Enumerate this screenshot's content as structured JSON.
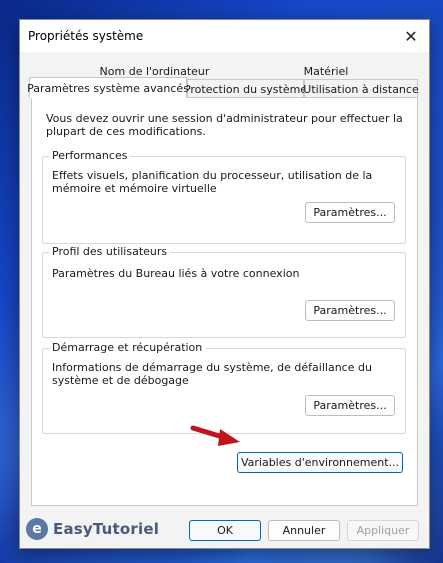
{
  "window": {
    "title": "Propriétés système"
  },
  "tabs_back": [
    {
      "label": "Nom de l'ordinateur"
    },
    {
      "label": "Matériel"
    }
  ],
  "tabs_front": [
    {
      "label": "Paramètres système avancés",
      "active": true
    },
    {
      "label": "Protection du système"
    },
    {
      "label": "Utilisation à distance"
    }
  ],
  "intro": "Vous devez ouvrir une session d'administrateur pour effectuer la plupart de ces modifications.",
  "groups": [
    {
      "title": "Performances",
      "text": "Effets visuels, planification du processeur, utilisation de la mémoire et mémoire virtuelle",
      "button": "Paramètres..."
    },
    {
      "title": "Profil des utilisateurs",
      "text": "Paramètres du Bureau liés à votre connexion",
      "button": "Paramètres..."
    },
    {
      "title": "Démarrage et récupération",
      "text": "Informations de démarrage du système, de défaillance du système et de débogage",
      "button": "Paramètres..."
    }
  ],
  "env_button": "Variables d'environnement...",
  "footer": {
    "ok": "OK",
    "cancel": "Annuler",
    "apply": "Appliquer"
  },
  "watermark": {
    "logo_letter": "e",
    "text": "EasyTutoriel"
  },
  "colors": {
    "accent": "#0067c0",
    "arrow": "#c0141c"
  }
}
